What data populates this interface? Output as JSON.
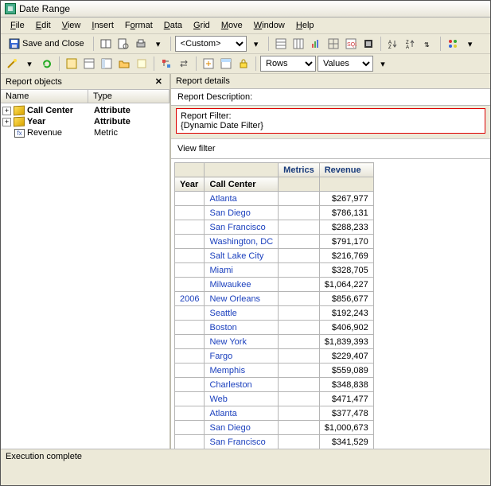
{
  "window": {
    "title": "Date Range"
  },
  "menu": {
    "file": "File",
    "edit": "Edit",
    "view": "View",
    "insert": "Insert",
    "format": "Format",
    "data": "Data",
    "grid": "Grid",
    "move": "Move",
    "window": "Window",
    "help": "Help"
  },
  "toolbar": {
    "save_close": "Save and Close",
    "custom_select": "<Custom>",
    "rows_select": "Rows",
    "values_select": "Values"
  },
  "left": {
    "title": "Report objects",
    "col_name": "Name",
    "col_type": "Type",
    "items": [
      {
        "name": "Call Center",
        "type": "Attribute",
        "bold": true,
        "icon": "cube",
        "exp": true
      },
      {
        "name": "Year",
        "type": "Attribute",
        "bold": true,
        "icon": "cube",
        "exp": true
      },
      {
        "name": "Revenue",
        "type": "Metric",
        "bold": false,
        "icon": "metric",
        "exp": false
      }
    ]
  },
  "right": {
    "details_title": "Report details",
    "desc_label": "Report Description:",
    "filter_label": "Report Filter:",
    "filter_value": "{Dynamic Date Filter}",
    "viewfilter": "View filter"
  },
  "grid": {
    "header_year": "Year",
    "header_callcenter": "Call Center",
    "header_metrics": "Metrics",
    "header_revenue": "Revenue",
    "year": "2006",
    "rows": [
      {
        "cc": "Atlanta",
        "rev": "$267,977"
      },
      {
        "cc": "San Diego",
        "rev": "$786,131"
      },
      {
        "cc": "San Francisco",
        "rev": "$288,233"
      },
      {
        "cc": "Washington, DC",
        "rev": "$791,170"
      },
      {
        "cc": "Salt Lake City",
        "rev": "$216,769"
      },
      {
        "cc": "Miami",
        "rev": "$328,705"
      },
      {
        "cc": "Milwaukee",
        "rev": "$1,064,227"
      },
      {
        "cc": "New Orleans",
        "rev": "$856,677"
      },
      {
        "cc": "Seattle",
        "rev": "$192,243"
      },
      {
        "cc": "Boston",
        "rev": "$406,902"
      },
      {
        "cc": "New York",
        "rev": "$1,839,393"
      },
      {
        "cc": "Fargo",
        "rev": "$229,407"
      },
      {
        "cc": "Memphis",
        "rev": "$559,089"
      },
      {
        "cc": "Charleston",
        "rev": "$348,838"
      },
      {
        "cc": "Web",
        "rev": "$471,477"
      },
      {
        "cc": "Atlanta",
        "rev": "$377,478"
      },
      {
        "cc": "San Diego",
        "rev": "$1,000,673"
      },
      {
        "cc": "San Francisco",
        "rev": "$341,529"
      }
    ]
  },
  "status": {
    "text": "Execution complete"
  }
}
